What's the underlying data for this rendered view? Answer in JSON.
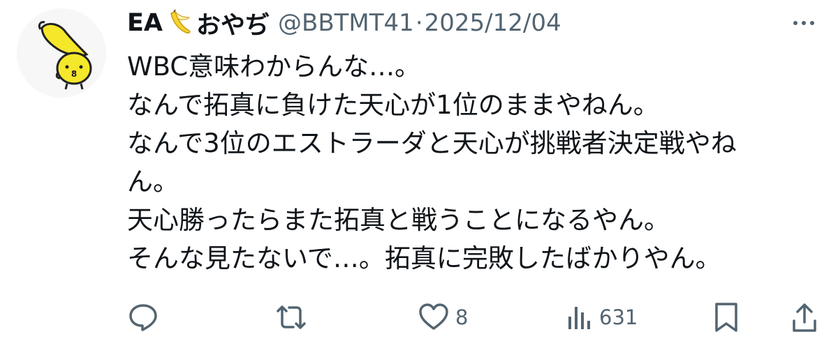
{
  "tweet": {
    "author": {
      "name_prefix": "EA",
      "name_emoji": "banana",
      "name_suffix": "おやぢ",
      "handle": "@BBTMT41",
      "separator": "·",
      "date": "2025/12/04",
      "avatar_icon": "banana-chick-avatar"
    },
    "lines": [
      "WBC意味わからんな…。",
      "なんで拓真に負けた天心が1位のままやねん。",
      "なんで3位のエストラーダと天心が挑戦者決定戦やね",
      "ん。",
      "天心勝ったらまた拓真と戦うことになるやん。",
      "そんな見たないで…。拓真に完敗したばかりやん。"
    ],
    "actions": {
      "reply": {
        "icon": "reply-icon",
        "count": ""
      },
      "retweet": {
        "icon": "retweet-icon",
        "count": ""
      },
      "like": {
        "icon": "heart-icon",
        "count": "8"
      },
      "views": {
        "icon": "views-icon",
        "count": "631"
      },
      "bookmark": {
        "icon": "bookmark-icon"
      },
      "share": {
        "icon": "share-icon"
      }
    }
  },
  "colors": {
    "text": "#0f1419",
    "secondary": "#536471",
    "avatar_yellow": "#f5e72a"
  }
}
